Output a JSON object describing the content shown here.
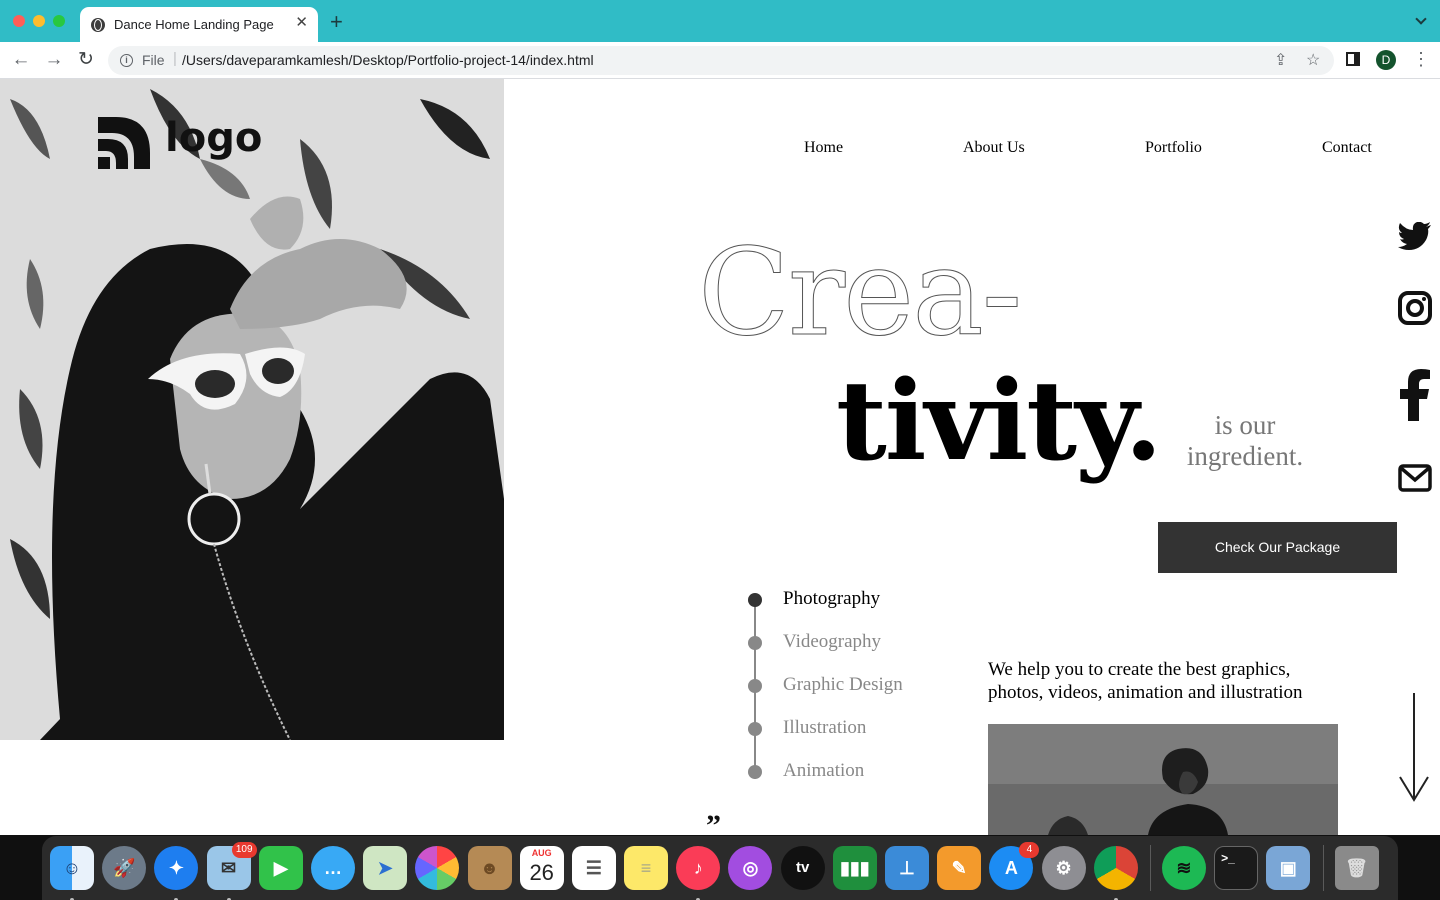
{
  "browser": {
    "tab_title": "Dance Home Landing Page",
    "tab_close": "✕",
    "new_tab": "+",
    "url_scheme": "File",
    "url_separator": "|",
    "url": "/Users/daveparamkamlesh/Desktop/Portfolio-project-14/index.html",
    "profile_initial": "D"
  },
  "site": {
    "logo_text": "logo",
    "nav": [
      "Home",
      "About Us",
      "Portfolio",
      "Contact"
    ],
    "headline_outline": "Crea-",
    "headline_solid": "tivity.",
    "tagline": "is our ingredient.",
    "cta_label": "Check Our Package",
    "services": [
      {
        "label": "Photography",
        "active": true
      },
      {
        "label": "Videography",
        "active": false
      },
      {
        "label": "Graphic Design",
        "active": false
      },
      {
        "label": "Illustration",
        "active": false
      },
      {
        "label": "Animation",
        "active": false
      }
    ],
    "blurb": "We help you to create the best graphics, photos, videos, animation and illustration",
    "quote_glyph": "”",
    "social_icons": [
      "twitter-icon",
      "instagram-icon",
      "facebook-icon",
      "mail-icon"
    ]
  },
  "dock": {
    "apps": [
      "Finder",
      "Launchpad",
      "Safari",
      "Mail",
      "FaceTime",
      "Messages",
      "Maps",
      "Photos",
      "Contacts",
      "Calendar",
      "Reminders",
      "Notes",
      "Music",
      "Podcasts",
      "TV",
      "Numbers",
      "Keynote",
      "Pages",
      "App Store",
      "System Preferences",
      "Google Chrome",
      "Spotify",
      "Terminal",
      "Preview",
      "Trash"
    ],
    "mail_badge": "109",
    "appstore_badge": "4",
    "calendar_month": "AUG",
    "calendar_day": "26",
    "tv_label": "tv",
    "terminal_prompt": ">_"
  }
}
